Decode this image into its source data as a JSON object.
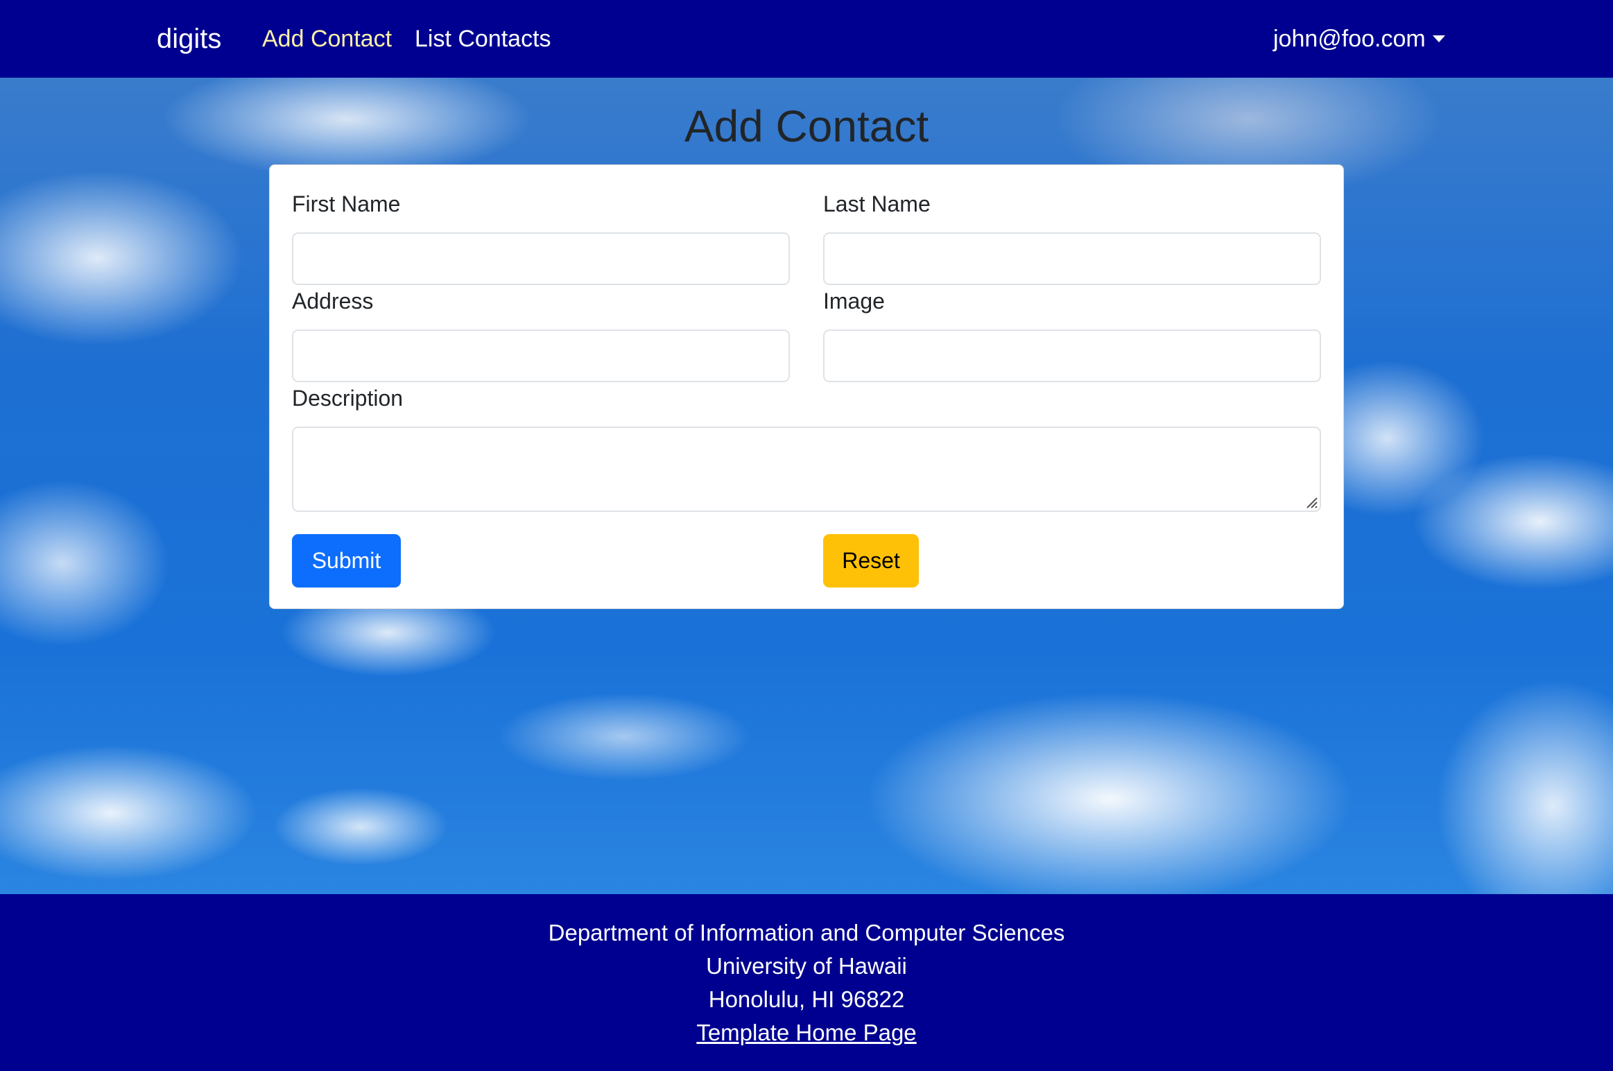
{
  "navbar": {
    "brand": "digits",
    "links": [
      {
        "label": "Add Contact",
        "active": true
      },
      {
        "label": "List Contacts",
        "active": false
      }
    ],
    "user": "john@foo.com",
    "user_icon": "caret-down-icon"
  },
  "main": {
    "title": "Add Contact",
    "form": {
      "first_name": {
        "label": "First Name",
        "value": ""
      },
      "last_name": {
        "label": "Last Name",
        "value": ""
      },
      "address": {
        "label": "Address",
        "value": ""
      },
      "image": {
        "label": "Image",
        "value": ""
      },
      "description": {
        "label": "Description",
        "value": ""
      },
      "submit_label": "Submit",
      "reset_label": "Reset"
    }
  },
  "footer": {
    "line1": "Department of Information and Computer Sciences",
    "line2": "University of Hawaii",
    "line3": "Honolulu, HI 96822",
    "link": "Template Home Page"
  },
  "colors": {
    "navbar_bg": "#000090",
    "active_link": "#fdf0a8",
    "submit_bg": "#0d6efd",
    "reset_bg": "#ffc107"
  }
}
